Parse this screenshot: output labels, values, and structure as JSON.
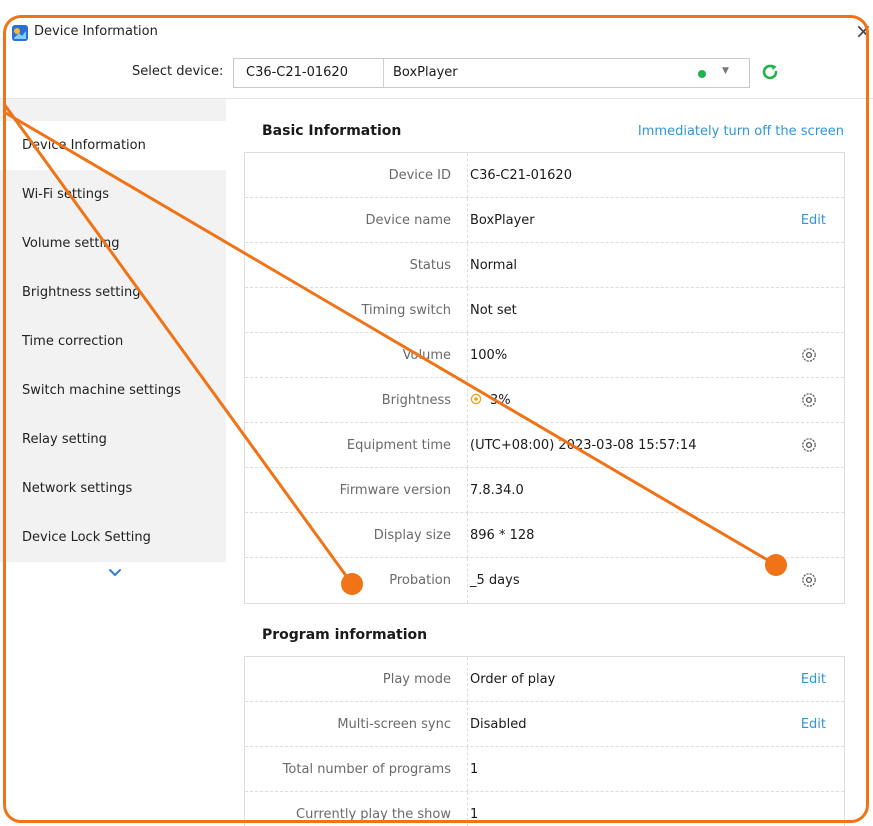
{
  "window": {
    "title": "Device Information",
    "close_glyph": "×",
    "app_icon": "app-logo-icon",
    "border_color": "#f07318"
  },
  "device_selector": {
    "label": "Select device:",
    "device_id": "C36-C21-01620",
    "device_name": "BoxPlayer",
    "status_color": "#21b24b",
    "dropdown_glyph": "▼",
    "refresh_icon": "refresh-icon"
  },
  "sidebar": {
    "items": [
      {
        "label": "Device Information",
        "active": true
      },
      {
        "label": "Wi-Fi settings"
      },
      {
        "label": "Volume setting"
      },
      {
        "label": "Brightness setting"
      },
      {
        "label": "Time correction"
      },
      {
        "label": "Switch machine settings"
      },
      {
        "label": "Relay setting"
      },
      {
        "label": "Network settings"
      },
      {
        "label": "Device Lock Setting"
      }
    ],
    "more_icon": "chevron-down-icon"
  },
  "basic_info": {
    "title": "Basic Information",
    "turn_off_link": "Immediately turn off the screen",
    "rows": [
      {
        "label": "Device ID",
        "value": "C36-C21-01620"
      },
      {
        "label": "Device name",
        "value": "BoxPlayer",
        "action": "Edit"
      },
      {
        "label": "Status",
        "value": "Normal"
      },
      {
        "label": "Timing switch",
        "value": "Not set"
      },
      {
        "label": "Volume",
        "value": "100%"
      },
      {
        "label": "Brightness",
        "value": "3%"
      },
      {
        "label": "Equipment time",
        "value": "(UTC+08:00) 2023-03-08 15:57:14"
      },
      {
        "label": "Firmware version",
        "value": "7.8.34.0"
      },
      {
        "label": "Display size",
        "value": "896 * 128"
      },
      {
        "label": "Probation",
        "value": "_5 days"
      }
    ]
  },
  "program_info": {
    "title": "Program information",
    "rows": [
      {
        "label": "Play mode",
        "value": "Order of play",
        "action": "Edit"
      },
      {
        "label": "Multi-screen sync",
        "value": "Disabled",
        "action": "Edit"
      },
      {
        "label": "Total number of programs",
        "value": "1"
      },
      {
        "label": "Currently play the show",
        "value": "1"
      }
    ]
  },
  "colors": {
    "accent_link": "#2f96d6",
    "annotation": "#f07318",
    "sidebar_bg": "#f2f2f2"
  }
}
